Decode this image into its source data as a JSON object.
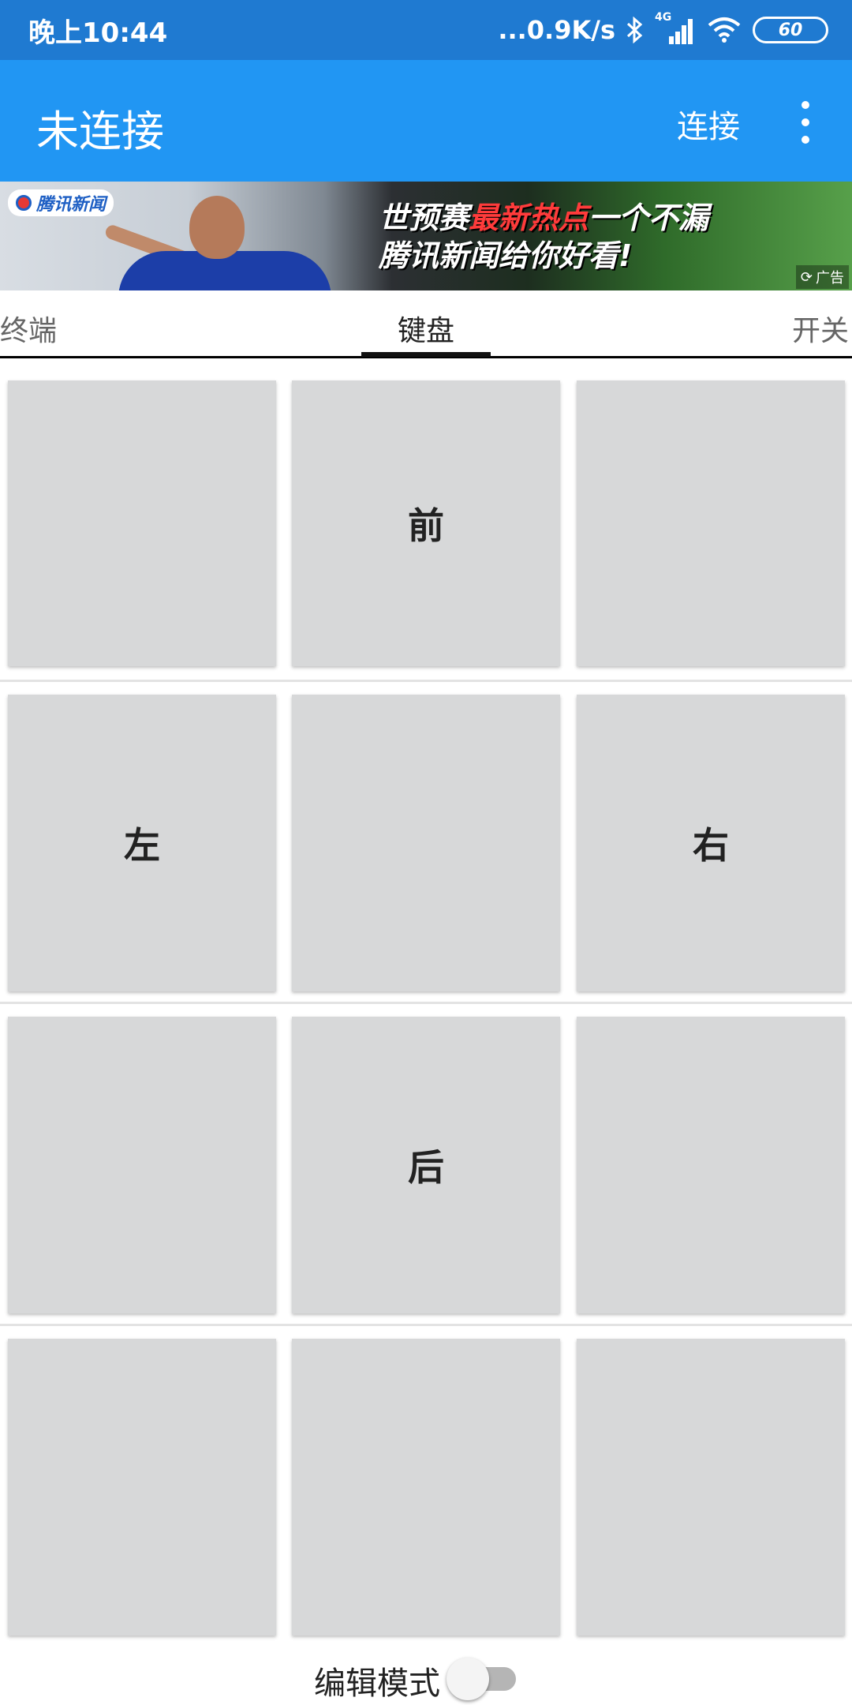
{
  "status_bar": {
    "time": "晚上10:44",
    "network_speed": "...0.9K/s",
    "signal_label": "4G",
    "battery": "60",
    "icons": [
      "bluetooth-icon",
      "signal-icon",
      "wifi-icon",
      "battery-icon"
    ]
  },
  "app_bar": {
    "title": "未连接",
    "connect_label": "连接",
    "more_icon": "more-vert-icon",
    "color": "#2196f3"
  },
  "ad": {
    "logo_text": "腾讯新闻",
    "line1_prefix": "世预赛",
    "line1_highlight": "最新热点",
    "line1_suffix": "一个不漏",
    "line2": "腾讯新闻给你好看!",
    "tag": "广告"
  },
  "tabs": [
    {
      "label": "终端",
      "active": false
    },
    {
      "label": "键盘",
      "active": true
    },
    {
      "label": "开关",
      "active": false
    }
  ],
  "keypad": {
    "rows": [
      [
        "",
        "前",
        ""
      ],
      [
        "左",
        "",
        "右"
      ],
      [
        "",
        "后",
        ""
      ],
      [
        "",
        "",
        ""
      ]
    ]
  },
  "edit_mode": {
    "label": "编辑模式",
    "enabled": false
  }
}
